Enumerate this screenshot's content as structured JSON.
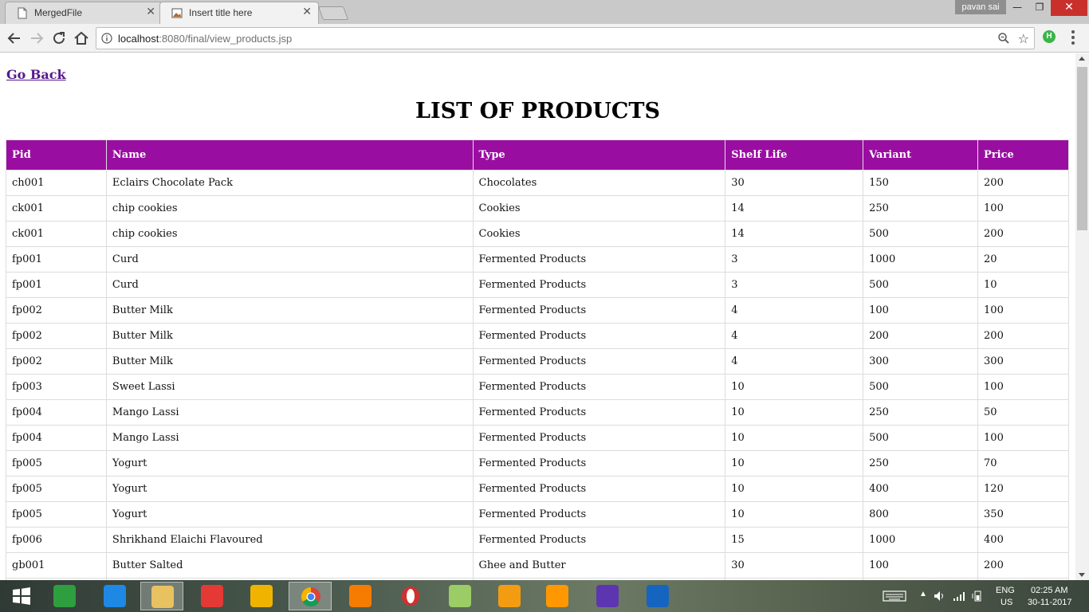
{
  "browser": {
    "tabs": [
      {
        "title": "MergedFile",
        "active": false
      },
      {
        "title": "Insert title here",
        "active": true
      }
    ],
    "user_name": "pavan sai",
    "url_host": "localhost",
    "url_rest": ":8080/final/view_products.jsp",
    "extension_letter": "H"
  },
  "page": {
    "go_back": "Go Back",
    "title": "LIST OF PRODUCTS",
    "columns": [
      "Pid",
      "Name",
      "Type",
      "Shelf Life",
      "Variant",
      "Price"
    ],
    "rows": [
      [
        "ch001",
        "Eclairs Chocolate Pack",
        "Chocolates",
        "30",
        "150",
        "200"
      ],
      [
        "ck001",
        "chip cookies",
        "Cookies",
        "14",
        "250",
        "100"
      ],
      [
        "ck001",
        "chip cookies",
        "Cookies",
        "14",
        "500",
        "200"
      ],
      [
        "fp001",
        "Curd",
        "Fermented Products",
        "3",
        "1000",
        "20"
      ],
      [
        "fp001",
        "Curd",
        "Fermented Products",
        "3",
        "500",
        "10"
      ],
      [
        "fp002",
        "Butter Milk",
        "Fermented Products",
        "4",
        "100",
        "100"
      ],
      [
        "fp002",
        "Butter Milk",
        "Fermented Products",
        "4",
        "200",
        "200"
      ],
      [
        "fp002",
        "Butter Milk",
        "Fermented Products",
        "4",
        "300",
        "300"
      ],
      [
        "fp003",
        "Sweet Lassi",
        "Fermented Products",
        "10",
        "500",
        "100"
      ],
      [
        "fp004",
        "Mango Lassi",
        "Fermented Products",
        "10",
        "250",
        "50"
      ],
      [
        "fp004",
        "Mango Lassi",
        "Fermented Products",
        "10",
        "500",
        "100"
      ],
      [
        "fp005",
        "Yogurt",
        "Fermented Products",
        "10",
        "250",
        "70"
      ],
      [
        "fp005",
        "Yogurt",
        "Fermented Products",
        "10",
        "400",
        "120"
      ],
      [
        "fp005",
        "Yogurt",
        "Fermented Products",
        "10",
        "800",
        "350"
      ],
      [
        "fp006",
        "Shrikhand Elaichi Flavoured",
        "Fermented Products",
        "15",
        "1000",
        "400"
      ],
      [
        "gb001",
        "Butter Salted",
        "Ghee and Butter",
        "30",
        "100",
        "200"
      ],
      [
        "",
        "",
        "",
        "",
        "",
        ""
      ]
    ],
    "header_color": "#990ea1",
    "link_color": "#551a8b"
  },
  "taskbar": {
    "apps": [
      {
        "name": "start-icon",
        "color": "#ffffff"
      },
      {
        "name": "store-icon",
        "color": "#2e9e3e"
      },
      {
        "name": "internet-explorer-icon",
        "color": "#1e88e5"
      },
      {
        "name": "file-explorer-icon",
        "color": "#e8c160"
      },
      {
        "name": "screen-recorder-icon",
        "color": "#e53935"
      },
      {
        "name": "winamp-icon",
        "color": "#f0b400"
      },
      {
        "name": "chrome-icon",
        "color": "#4caf50"
      },
      {
        "name": "mi-icon",
        "color": "#f57c00"
      },
      {
        "name": "opera-icon",
        "color": "#d32f2f"
      },
      {
        "name": "notes-icon",
        "color": "#9ccc65"
      },
      {
        "name": "sublime-text-icon",
        "color": "#f39c12"
      },
      {
        "name": "media-player-icon",
        "color": "#ff9800"
      },
      {
        "name": "eclipse-java-ee-icon",
        "color": "#5e35b1"
      },
      {
        "name": "mysql-workbench-icon",
        "color": "#1565c0"
      }
    ],
    "lang_line1": "ENG",
    "lang_line2": "US",
    "time": "02:25 AM",
    "date": "30-11-2017"
  }
}
